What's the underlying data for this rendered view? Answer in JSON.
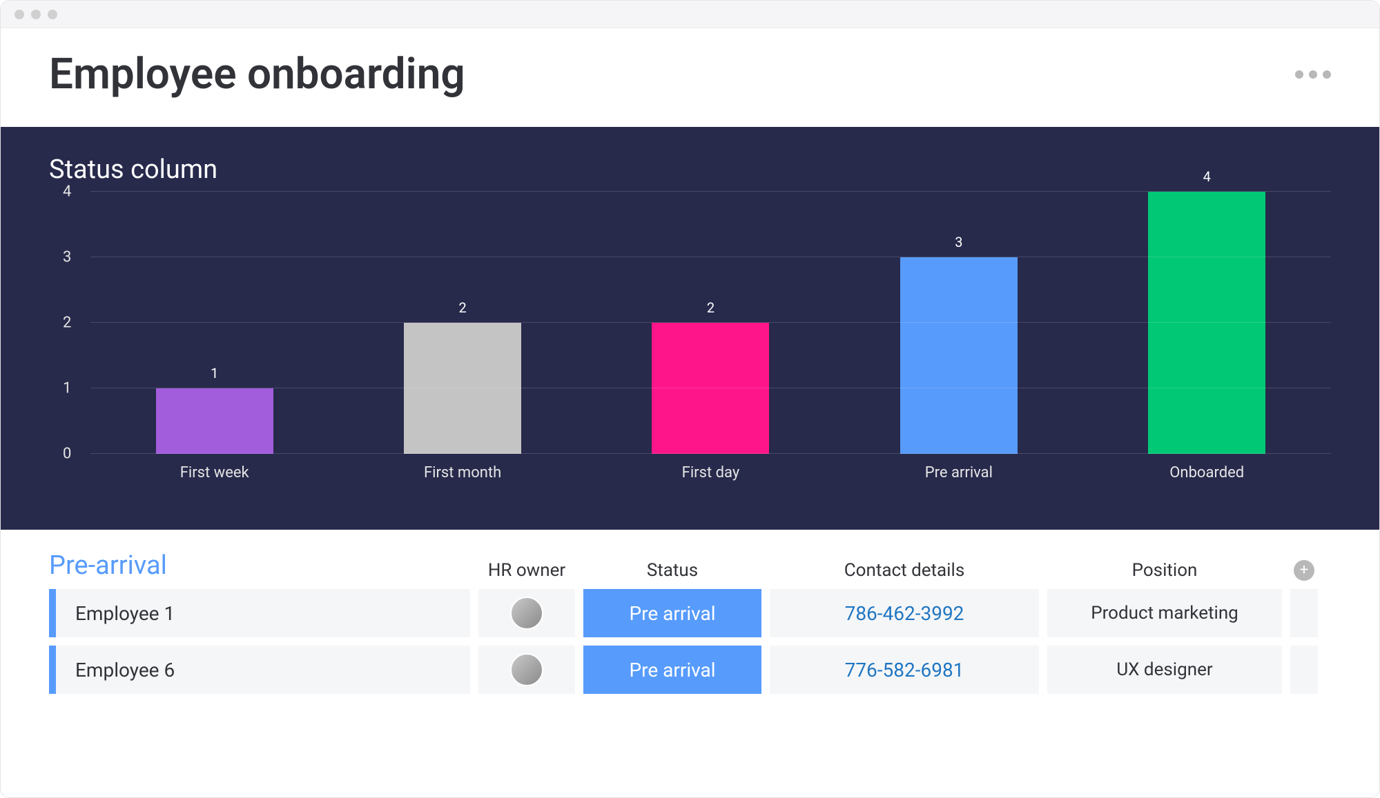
{
  "page_title": "Employee onboarding",
  "chart_panel": {
    "title": "Status column"
  },
  "chart_data": {
    "type": "bar",
    "title": "Status column",
    "xlabel": "",
    "ylabel": "",
    "ylim": [
      0,
      4
    ],
    "yticks": [
      0,
      1,
      2,
      3,
      4
    ],
    "categories": [
      "First week",
      "First month",
      "First day",
      "Pre arrival",
      "Onboarded"
    ],
    "values": [
      1,
      2,
      2,
      3,
      4
    ],
    "colors": [
      "#a25ddc",
      "#c4c4c4",
      "#ff158a",
      "#579bfc",
      "#00c875"
    ]
  },
  "table": {
    "group_title": "Pre-arrival",
    "group_color": "#579bfc",
    "columns": {
      "owner": "HR owner",
      "status": "Status",
      "contact": "Contact details",
      "position": "Position"
    },
    "rows": [
      {
        "name": "Employee 1",
        "status": {
          "label": "Pre arrival",
          "color": "#579bfc"
        },
        "contact": "786-462-3992",
        "position": "Product marketing"
      },
      {
        "name": "Employee 6",
        "status": {
          "label": "Pre arrival",
          "color": "#579bfc"
        },
        "contact": "776-582-6981",
        "position": "UX designer"
      }
    ]
  }
}
